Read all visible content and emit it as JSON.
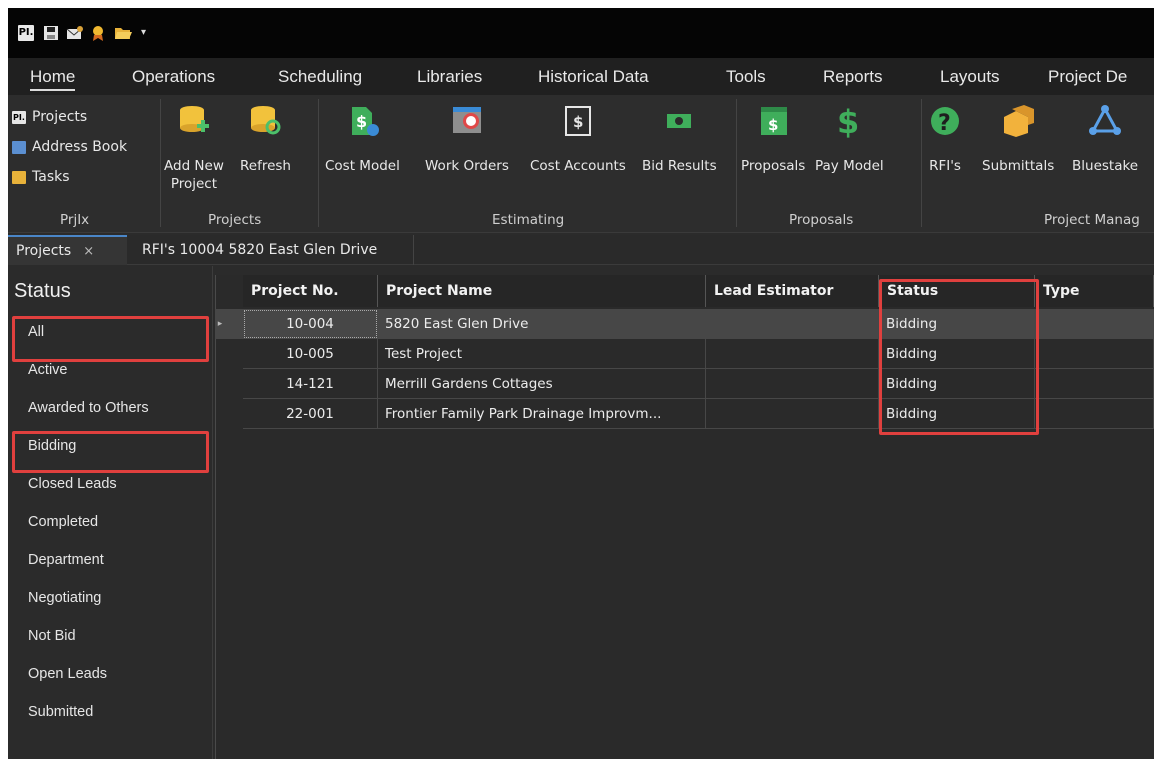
{
  "qat": {
    "logo": "PI."
  },
  "menu": {
    "tabs": [
      "Home",
      "Operations",
      "Scheduling",
      "Libraries",
      "Historical Data",
      "Tools",
      "Reports",
      "Layouts",
      "Project De"
    ]
  },
  "ribbon": {
    "prjix": {
      "items": [
        "Projects",
        "Address Book",
        "Tasks"
      ],
      "group": "PrjIx"
    },
    "projects": {
      "add_new": "Add New\nProject",
      "refresh": "Refresh",
      "group": "Projects"
    },
    "estimating": {
      "buttons": [
        "Cost Model",
        "Work Orders",
        "Cost Accounts",
        "Bid Results"
      ],
      "group": "Estimating"
    },
    "proposals": {
      "buttons": [
        "Proposals",
        "Pay Model"
      ],
      "group": "Proposals"
    },
    "pm": {
      "buttons": [
        "RFI's",
        "Submittals",
        "Bluestake"
      ],
      "group": "Project Manag"
    }
  },
  "doc_tabs": {
    "projects": "Projects",
    "close": "×",
    "rfi": "RFI's 10004 5820 East Glen Drive"
  },
  "sidebar": {
    "title": "Status",
    "items": [
      "All",
      "Active",
      "Awarded to Others",
      "Bidding",
      "Closed Leads",
      "Completed",
      "Department",
      "Negotiating",
      "Not Bid",
      "Open Leads",
      "Submitted"
    ]
  },
  "grid": {
    "columns": [
      "Project No.",
      "Project Name",
      "Lead Estimator",
      "Status",
      "Type"
    ],
    "rows": [
      {
        "no": "10-004",
        "name": "5820 East Glen Drive",
        "estimator": "",
        "status": "Bidding",
        "type": ""
      },
      {
        "no": "10-005",
        "name": "Test Project",
        "estimator": "",
        "status": "Bidding",
        "type": ""
      },
      {
        "no": "14-121",
        "name": "Merrill Gardens Cottages",
        "estimator": "",
        "status": "Bidding",
        "type": ""
      },
      {
        "no": "22-001",
        "name": "Frontier Family Park Drainage Improvm...",
        "estimator": "",
        "status": "Bidding",
        "type": ""
      }
    ]
  },
  "colors": {
    "highlight": "#e0403e",
    "selected_row": "#474747",
    "accent_blue": "#4a86c8"
  }
}
